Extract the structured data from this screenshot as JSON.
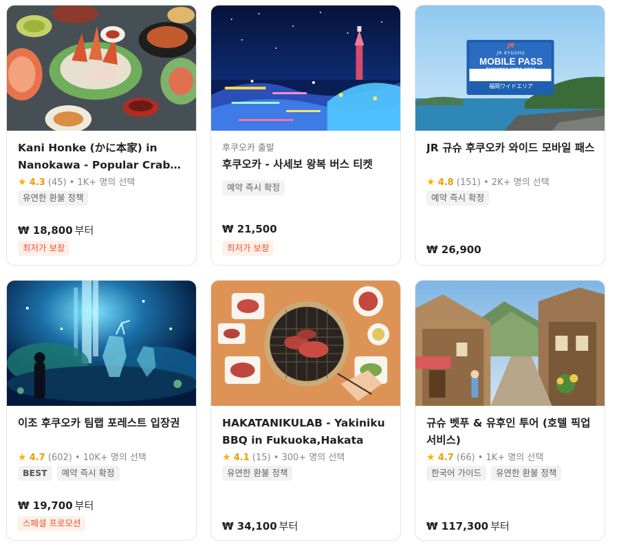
{
  "cards": [
    {
      "subtitle": "",
      "title": "Kani Honke (かに本家) in Nanokawa - Popular Crab Restaurant",
      "rating": {
        "score": "4.3",
        "reviews": "(45)",
        "selections": "• 1K+ 명의 선택"
      },
      "tags": [
        "유연한 환불 정책"
      ],
      "price": "₩ 18,800",
      "price_suffix": "부터",
      "promo": "최저가 보장",
      "image": "crab-feast-photo"
    },
    {
      "subtitle": "후쿠오카 출발",
      "title": "후쿠오카 - 사세보 왕복 버스 티켓",
      "rating": null,
      "tags": [
        "예약 즉시 확정"
      ],
      "price": "₩ 21,500",
      "price_suffix": "",
      "promo": "최저가 보장",
      "image": "night-illumination-photo"
    },
    {
      "subtitle": "",
      "title": "JR 규슈 후쿠오카 와이드 모바일 패스",
      "rating": {
        "score": "4.8",
        "reviews": "(151)",
        "selections": "• 2K+ 명의 선택"
      },
      "tags": [
        "예약 즉시 확정"
      ],
      "price": "₩ 26,900",
      "price_suffix": "",
      "promo": "",
      "image": "jr-pass-coast-photo",
      "pass_card": {
        "brand": "JR",
        "line1": "JR KYUSHU",
        "line2": "MOBILE PASS",
        "line3": "FUKUOKA WIDE AREA",
        "line4": "福岡ワイドエリア"
      }
    },
    {
      "subtitle": "",
      "title": "이조 후쿠오카 팀랩 포레스트 입장권",
      "rating": {
        "score": "4.7",
        "reviews": "(602)",
        "selections": "• 10K+ 명의 선택"
      },
      "tags": [
        "BEST",
        "예약 즉시 확정"
      ],
      "price": "₩ 19,700",
      "price_suffix": "부터",
      "promo": "스페셜 프로모션",
      "image": "teamlab-forest-photo"
    },
    {
      "subtitle": "",
      "title": "HAKATANIKULAB - Yakiniku BBQ in Fukuoka,Hakata",
      "rating": {
        "score": "4.1",
        "reviews": "(15)",
        "selections": "• 300+ 명의 선택"
      },
      "tags": [
        "유연한 환불 정책"
      ],
      "price": "₩ 34,100",
      "price_suffix": "부터",
      "promo": "",
      "image": "yakiniku-grill-photo"
    },
    {
      "subtitle": "",
      "title": "규슈 벳푸 & 유후인 투어 (호텔 픽업 서비스)",
      "rating": {
        "score": "4.7",
        "reviews": "(66)",
        "selections": "• 1K+ 명의 선택"
      },
      "tags": [
        "한국어 가이드",
        "유연한 환불 정책"
      ],
      "price": "₩ 117,300",
      "price_suffix": "부터",
      "promo": "",
      "image": "yufuin-street-photo"
    }
  ],
  "colors": {
    "star": "#ffb000",
    "promo_text": "#f0542e",
    "promo_bg": "#fff0ea",
    "tag_bg": "#f2f2f2"
  }
}
